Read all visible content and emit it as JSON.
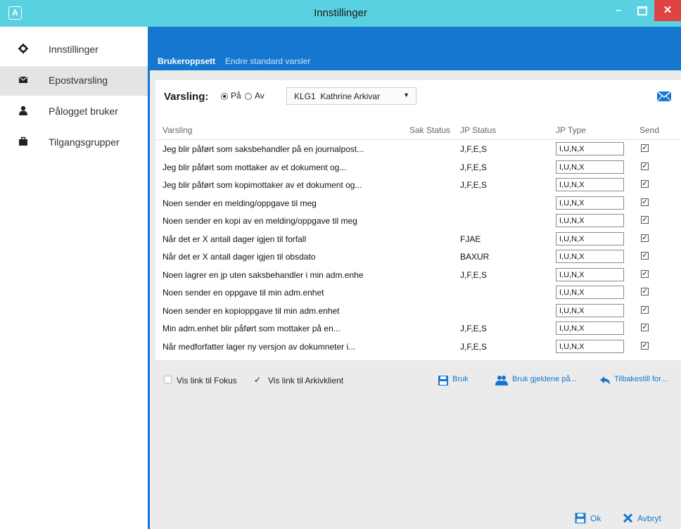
{
  "window": {
    "title": "Innstillinger",
    "app_icon": "A",
    "minimize": "–",
    "close": "✕"
  },
  "sidebar": {
    "items": [
      {
        "label": "Innstillinger",
        "icon": "gear-icon",
        "active": false
      },
      {
        "label": "Epostvarsling",
        "icon": "envelope-icon",
        "active": true
      },
      {
        "label": "Pålogget bruker",
        "icon": "user-icon",
        "active": false
      },
      {
        "label": "Tilgangsgrupper",
        "icon": "briefcase-icon",
        "active": false
      }
    ]
  },
  "tabs": [
    {
      "label": "Brukeroppsett",
      "active": true
    },
    {
      "label": "Endre standard varsler",
      "active": false
    }
  ],
  "notification": {
    "label": "Varsling:",
    "on_label": "På",
    "off_label": "Av",
    "selected": "on",
    "user_select": {
      "code": "KLG1",
      "name": "Kathrine Arkivar"
    }
  },
  "table": {
    "columns": [
      "Varsling",
      "Sak Status",
      "JP Status",
      "JP Type",
      "Send"
    ],
    "rows": [
      {
        "varsling": "Jeg blir påført som saksbehandler på en journalpost...",
        "sak_status": "",
        "jp_status": "J,F,E,S",
        "jp_type": "I,U,N,X",
        "send": true
      },
      {
        "varsling": "Jeg blir påført som mottaker av et dokument og...",
        "sak_status": "",
        "jp_status": "J,F,E,S",
        "jp_type": "I,U,N,X",
        "send": true
      },
      {
        "varsling": "Jeg blir påført som kopimottaker av et dokument og...",
        "sak_status": "",
        "jp_status": "J,F,E,S",
        "jp_type": "I,U,N,X",
        "send": true
      },
      {
        "varsling": "Noen sender en melding/oppgave til meg",
        "sak_status": "",
        "jp_status": "",
        "jp_type": "I,U,N,X",
        "send": true
      },
      {
        "varsling": "Noen sender en kopi av en melding/oppgave til meg",
        "sak_status": "",
        "jp_status": "",
        "jp_type": "I,U,N,X",
        "send": true
      },
      {
        "varsling": "Når det er X antall dager igjen til forfall",
        "sak_status": "",
        "jp_status": "FJAE",
        "jp_type": "I,U,N,X",
        "send": true
      },
      {
        "varsling": "Når det er X antall dager igjen til obsdato",
        "sak_status": "",
        "jp_status": "BAXUR",
        "jp_type": "I,U,N,X",
        "send": true
      },
      {
        "varsling": "Noen lagrer en jp uten saksbehandler i min adm.enhe",
        "sak_status": "",
        "jp_status": "J,F,E,S",
        "jp_type": "I,U,N,X",
        "send": true
      },
      {
        "varsling": "Noen sender en oppgave til min adm.enhet",
        "sak_status": "",
        "jp_status": "",
        "jp_type": "I,U,N,X",
        "send": true
      },
      {
        "varsling": "Noen sender en kopioppgave til min adm.enhet",
        "sak_status": "",
        "jp_status": "",
        "jp_type": "I,U,N,X",
        "send": true
      },
      {
        "varsling": "Min adm.enhet blir påført som mottaker på en...",
        "sak_status": "",
        "jp_status": "J,F,E,S",
        "jp_type": "I,U,N,X",
        "send": true
      },
      {
        "varsling": "Når medforfatter lager ny versjon av dokumneter i...",
        "sak_status": "",
        "jp_status": "J,F,E,S",
        "jp_type": "I,U,N,X",
        "send": true
      }
    ]
  },
  "options": {
    "fokus_label": "Vis link til Fokus",
    "fokus_checked": false,
    "arkiv_label": "Vis link til Arkivklient",
    "arkiv_checked": true
  },
  "actions": {
    "apply": "Bruk",
    "apply_current": "Bruk gjeldene på...",
    "reset": "Tilbakestill for..."
  },
  "buttons": {
    "ok": "Ok",
    "cancel": "Avbryt"
  },
  "colors": {
    "accent": "#1577cf",
    "titlebar": "#5ad1e0",
    "close": "#e04343"
  }
}
